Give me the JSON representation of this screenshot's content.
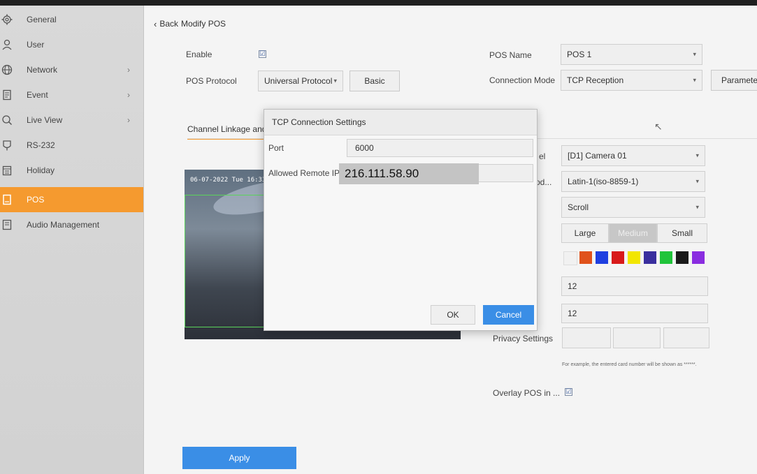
{
  "sidebar": {
    "items": [
      {
        "label": "General",
        "icon": "gear-icon",
        "chevron": ""
      },
      {
        "label": "User",
        "icon": "user-icon",
        "chevron": ""
      },
      {
        "label": "Network",
        "icon": "globe-icon",
        "chevron": "›"
      },
      {
        "label": "Event",
        "icon": "event-icon",
        "chevron": "›"
      },
      {
        "label": "Live View",
        "icon": "live-view-icon",
        "chevron": "›"
      },
      {
        "label": "RS-232",
        "icon": "rs232-icon",
        "chevron": ""
      },
      {
        "label": "Holiday",
        "icon": "holiday-icon",
        "chevron": ""
      },
      {
        "label": "POS",
        "icon": "pos-icon",
        "chevron": ""
      },
      {
        "label": "Audio Management",
        "icon": "audio-icon",
        "chevron": ""
      }
    ],
    "active_index": 7,
    "active_color": "#f59a2f"
  },
  "header": {
    "back_label": "Back",
    "title": "Modify POS"
  },
  "form": {
    "enable_label": "Enable",
    "enable_checked": "☑",
    "pos_protocol_label": "POS Protocol",
    "pos_protocol_value": "Universal Protocol",
    "basic_button": "Basic",
    "pos_name_label": "POS Name",
    "pos_name_value": "POS 1",
    "connection_mode_label": "Connection Mode",
    "connection_mode_value": "TCP Reception",
    "parameter_button": "Parameter",
    "channel_tab": "Channel Linkage and Display",
    "channel_label_fragment": "el",
    "channel_value": "[D1] Camera 01",
    "encoding_label_fragment": "cod...",
    "encoding_value": "Latin-1(iso-8859-1)",
    "overlay_mode_value": "Scroll",
    "font_sizes": [
      "Large",
      "Medium",
      "Small"
    ],
    "font_size_selected": 1,
    "colors": [
      "#f1f1f1",
      "#e0521b",
      "#1f3fe0",
      "#d81a1a",
      "#f2e600",
      "#3a2f9e",
      "#20c43a",
      "#1a1a1a",
      "#8a2de0"
    ],
    "value_1": "12",
    "value_2": "12",
    "privacy_label": "Privacy Settings",
    "privacy_hint": "For example, the entered card number will be shown as ******.",
    "overlay_pos_label": "Overlay POS in ...",
    "overlay_pos_checked": "☑",
    "apply_button": "Apply",
    "preview_osd": "06-07-2022 Tue 16:33"
  },
  "dialog": {
    "title": "TCP Connection Settings",
    "port_label": "Port",
    "port_value": "6000",
    "allowed_ip_label": "Allowed Remote IP A...",
    "allowed_ip_value": "216.111.58.90",
    "ok_button": "OK",
    "cancel_button": "Cancel"
  }
}
